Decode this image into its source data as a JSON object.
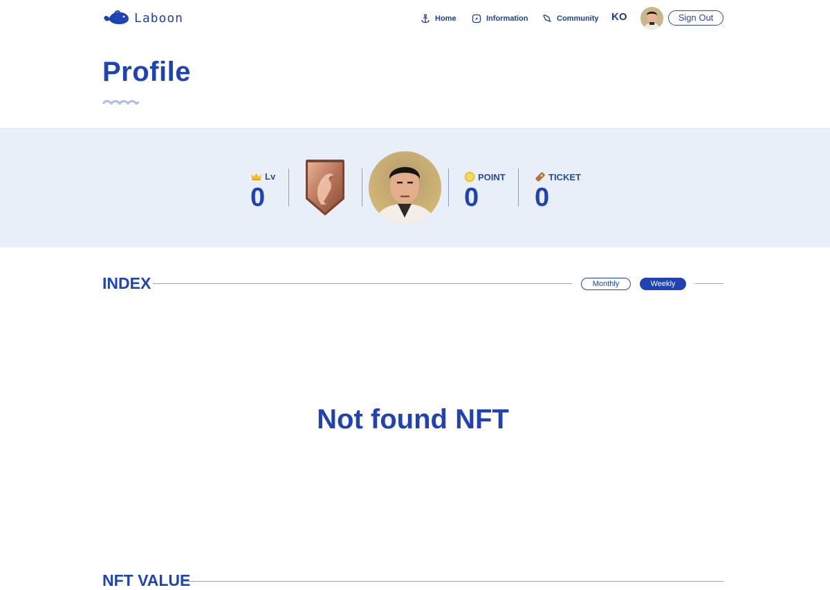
{
  "header": {
    "logo_text": "Laboon",
    "nav": [
      {
        "label": "Home",
        "icon": "anchor-icon"
      },
      {
        "label": "Information",
        "icon": "compass-icon"
      },
      {
        "label": "Community",
        "icon": "chat-icon"
      }
    ],
    "language": "KO",
    "sign_out_label": "Sign Out"
  },
  "page": {
    "title": "Profile"
  },
  "profile": {
    "level_label": "Lv",
    "level_value": "0",
    "point_label": "POINT",
    "point_value": "0",
    "ticket_label": "TICKET",
    "ticket_value": "0",
    "badge_icon": "dolphin-badge-icon"
  },
  "index": {
    "title": "INDEX",
    "tabs": [
      {
        "label": "Monthly",
        "active": false
      },
      {
        "label": "Weekly",
        "active": true
      }
    ],
    "empty_message": "Not found NFT"
  },
  "nft_value": {
    "title": "NFT VALUE"
  },
  "colors": {
    "brand": "#1f43b2",
    "band_background": "#e9eff8"
  }
}
